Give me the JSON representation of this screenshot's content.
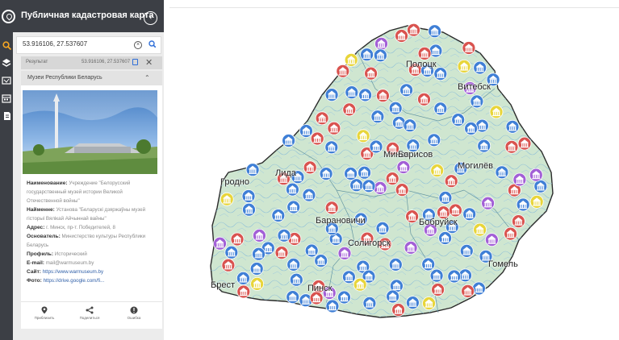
{
  "app": {
    "title": "Публичная кадастровая карта"
  },
  "toolbar": {
    "tools": [
      "search-icon",
      "layers-icon",
      "draw-icon",
      "calendar-icon",
      "documents-icon"
    ]
  },
  "search": {
    "value": "53.916106, 27.537607",
    "placeholder": ""
  },
  "result": {
    "label": "Результат",
    "coords": "53.916106, 27.537607"
  },
  "card": {
    "title": "Музеи Республики Беларусь",
    "fields": [
      {
        "label": "Наименование:",
        "value": "Учреждение \"Белорусский государственный музей истории Великой Отечественной войны\""
      },
      {
        "label": "Найменне:",
        "value": "Установа \"Беларускі дзяржаўны музей гісторыі Вялікай Айчыннай вайны\""
      },
      {
        "label": "Адрес:",
        "value": "г. Минск, пр-т. Победителей, 8"
      },
      {
        "label": "Основатель:",
        "value": "Министерство культуры Республики Беларусь"
      },
      {
        "label": "Профиль:",
        "value": "Исторический"
      },
      {
        "label": "E-mail:",
        "value": "mail@warmuseum.by"
      },
      {
        "label": "Сайт:",
        "value": "https://www.warmuseum.by"
      },
      {
        "label": "Фото:",
        "value": "https://drive.google.com/fi..."
      }
    ],
    "actions": [
      {
        "label": "Приблизить",
        "icon": "location-pin-icon"
      },
      {
        "label": "Поделиться",
        "icon": "share-icon"
      },
      {
        "label": "Ошибка",
        "icon": "error-icon"
      }
    ]
  },
  "map": {
    "cities": [
      "Гродно",
      "Лида",
      "Минск",
      "Барановичи",
      "Солигорск",
      "Брест",
      "Пинск",
      "Бобруйск",
      "Могилёв",
      "Гомель",
      "Борисов",
      "Витебск",
      "Полоцк"
    ],
    "marker_colors": {
      "blue": "#3f7fd6",
      "red": "#d9534f",
      "yellow": "#e8d53a",
      "purple": "#a25fd6"
    },
    "border_color": "#2a2a2a",
    "land_color": "#cfe6d0",
    "marker_icon": "museum-icon"
  }
}
